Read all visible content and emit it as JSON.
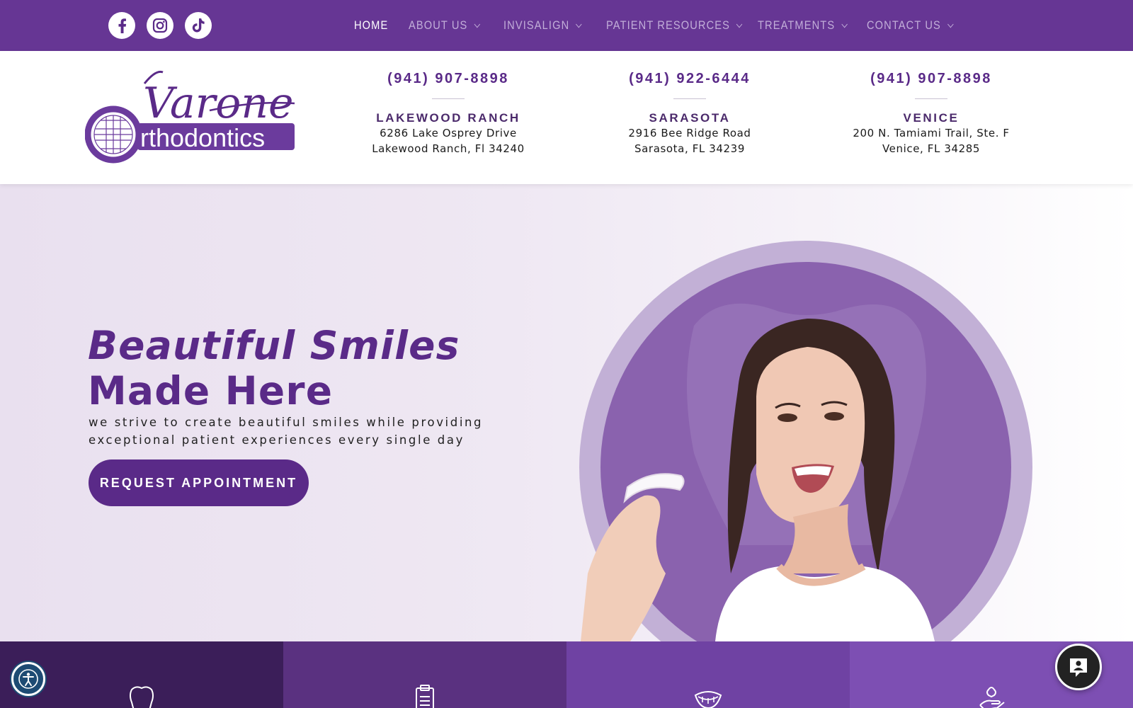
{
  "social": [
    {
      "name": "facebook-icon"
    },
    {
      "name": "instagram-icon"
    },
    {
      "name": "tiktok-icon"
    }
  ],
  "nav": [
    {
      "label": "HOME",
      "active": true,
      "dropdown": false
    },
    {
      "label": "ABOUT US",
      "active": false,
      "dropdown": true
    },
    {
      "label": "INVISALIGN",
      "active": false,
      "dropdown": true
    },
    {
      "label": "PATIENT RESOURCES",
      "active": false,
      "dropdown": true
    },
    {
      "label": "TREATMENTS",
      "active": false,
      "dropdown": true
    },
    {
      "label": "CONTACT US",
      "active": false,
      "dropdown": true
    }
  ],
  "logo": {
    "line1": "Varone",
    "line2": "rthodontics"
  },
  "locations": [
    {
      "phone": "(941) 907-8898",
      "name": "LAKEWOOD RANCH",
      "address1": "6286 Lake Osprey Drive",
      "address2": "Lakewood Ranch, Fl 34240"
    },
    {
      "phone": "(941) 922-6444",
      "name": "SARASOTA",
      "address1": "2916 Bee Ridge Road",
      "address2": "Sarasota, FL 34239"
    },
    {
      "phone": "(941) 907-8898",
      "name": "VENICE",
      "address1": "200 N. Tamiami Trail, Ste. F",
      "address2": "Venice, FL 34285"
    }
  ],
  "hero": {
    "title_line1": "Beautiful Smiles",
    "title_line2": "Made Here",
    "subtitle_line1": "we strive to create beautiful smiles while providing",
    "subtitle_line2": "exceptional patient experiences every single day",
    "cta": "REQUEST APPOINTMENT"
  },
  "features": [
    {
      "icon": "tooth-icon",
      "color": "#3b1e59"
    },
    {
      "icon": "clipboard-icon",
      "color": "#5a3180"
    },
    {
      "icon": "smile-icon",
      "color": "#6f42a3"
    },
    {
      "icon": "hand-icon",
      "color": "#7d4fb3"
    }
  ],
  "colors": {
    "brand": "#663694",
    "brand_dark": "#5a2a88",
    "hero_bg": "#ece4f1"
  }
}
